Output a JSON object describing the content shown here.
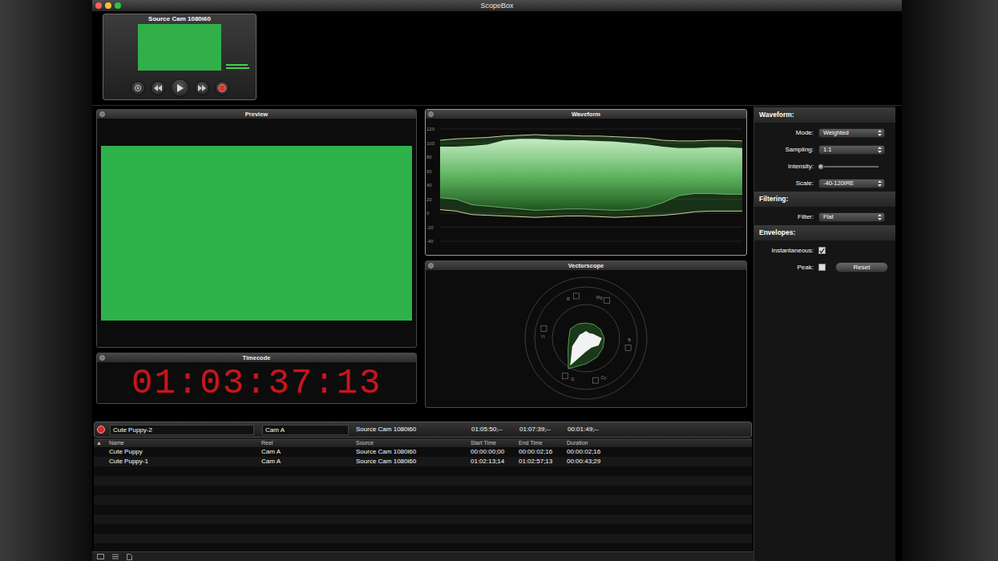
{
  "window": {
    "title": "ScopeBox"
  },
  "source": {
    "title": "Source Cam 1080i60",
    "meters": [
      {
        "level": 0.9
      },
      {
        "level": 0.95
      }
    ],
    "transport": [
      {
        "kind": "settings"
      },
      {
        "kind": "rewind"
      },
      {
        "kind": "play"
      },
      {
        "kind": "forward"
      },
      {
        "kind": "record"
      }
    ]
  },
  "preview": {
    "title": "Preview"
  },
  "timecode": {
    "title": "Timecode",
    "value": "01:03:37:13"
  },
  "waveform": {
    "title": "Waveform",
    "ticks": [
      "120",
      "100",
      "80",
      "60",
      "40",
      "20",
      "0",
      "-20",
      "-40"
    ],
    "peak_high": [
      104,
      106,
      107,
      108,
      110,
      111,
      112,
      111,
      111,
      110,
      110,
      109,
      108,
      107,
      104,
      103,
      103,
      104,
      104,
      103
    ],
    "peak_low": [
      5,
      3,
      -2,
      -3,
      -4,
      -5,
      -6,
      -5,
      -4,
      -4,
      -5,
      -6,
      -5,
      -4,
      -3,
      -1,
      2,
      3,
      3,
      3
    ],
    "luma_high": [
      95,
      95,
      96,
      98,
      104,
      106,
      106,
      105,
      104,
      104,
      103,
      102,
      100,
      98,
      95,
      93,
      93,
      94,
      94,
      93
    ],
    "luma_low": [
      22,
      20,
      12,
      10,
      8,
      6,
      4,
      5,
      6,
      6,
      5,
      4,
      5,
      8,
      15,
      25,
      28,
      28,
      27,
      27
    ]
  },
  "vectorscope": {
    "title": "Vectorscope",
    "targets": [
      {
        "label": "R",
        "angle": 103
      },
      {
        "label": "Mg",
        "angle": 61
      },
      {
        "label": "B",
        "angle": 347
      },
      {
        "label": "Cy",
        "angle": 283
      },
      {
        "label": "G",
        "angle": 241
      },
      {
        "label": "Yl",
        "angle": 167
      }
    ],
    "outline": [
      0.3,
      0.28,
      0.26,
      0.25,
      0.27,
      0.3,
      0.28,
      0.34,
      0.58,
      0.42,
      0.36,
      0.32
    ],
    "core": [
      0.26,
      0.14,
      0.1,
      0.12,
      0.1,
      0.12,
      0.14,
      0.26,
      0.52,
      0.22,
      0.18,
      0.24
    ]
  },
  "settings": {
    "sections": [
      {
        "title": "Waveform:",
        "rows": [
          {
            "kind": "select",
            "label": "Mode:",
            "value": "Weighted"
          },
          {
            "kind": "select",
            "label": "Sampling:",
            "value": "1:1"
          },
          {
            "kind": "slider",
            "label": "Intensity:",
            "level": 0.04
          },
          {
            "kind": "select",
            "label": "Scale:",
            "value": "-40-120IRE"
          }
        ]
      },
      {
        "title": "Filtering:",
        "rows": [
          {
            "kind": "select",
            "label": "Filter:",
            "value": "Flat"
          }
        ]
      },
      {
        "title": "Envelopes:",
        "rows": [
          {
            "kind": "checkbox",
            "label": "Instantaneous:",
            "checked": true
          },
          {
            "kind": "checkbox",
            "label": "Peak:",
            "checked": false,
            "button": "Reset"
          }
        ]
      }
    ]
  },
  "recorder": {
    "name": "Cute Puppy-2",
    "reel": "Cam A",
    "source": "Source Cam 1080i60",
    "start": "01:05:50;--",
    "end": "01:07:39;--",
    "duration": "00:01:49;--"
  },
  "table": {
    "sort_icon": "▲",
    "columns": [
      "Name",
      "Reel",
      "Source",
      "Start Time",
      "End Time",
      "Duration"
    ],
    "rows": [
      [
        "Cute Puppy",
        "Cam A",
        "Source Cam 1080i60",
        "00:00:00;00",
        "00:00:02;16",
        "00:00:02;16"
      ],
      [
        "Cute Puppy-1",
        "Cam A",
        "Source Cam 1080i60",
        "01:02:13;14",
        "01:02:57;13",
        "00:00:43;29"
      ]
    ]
  }
}
